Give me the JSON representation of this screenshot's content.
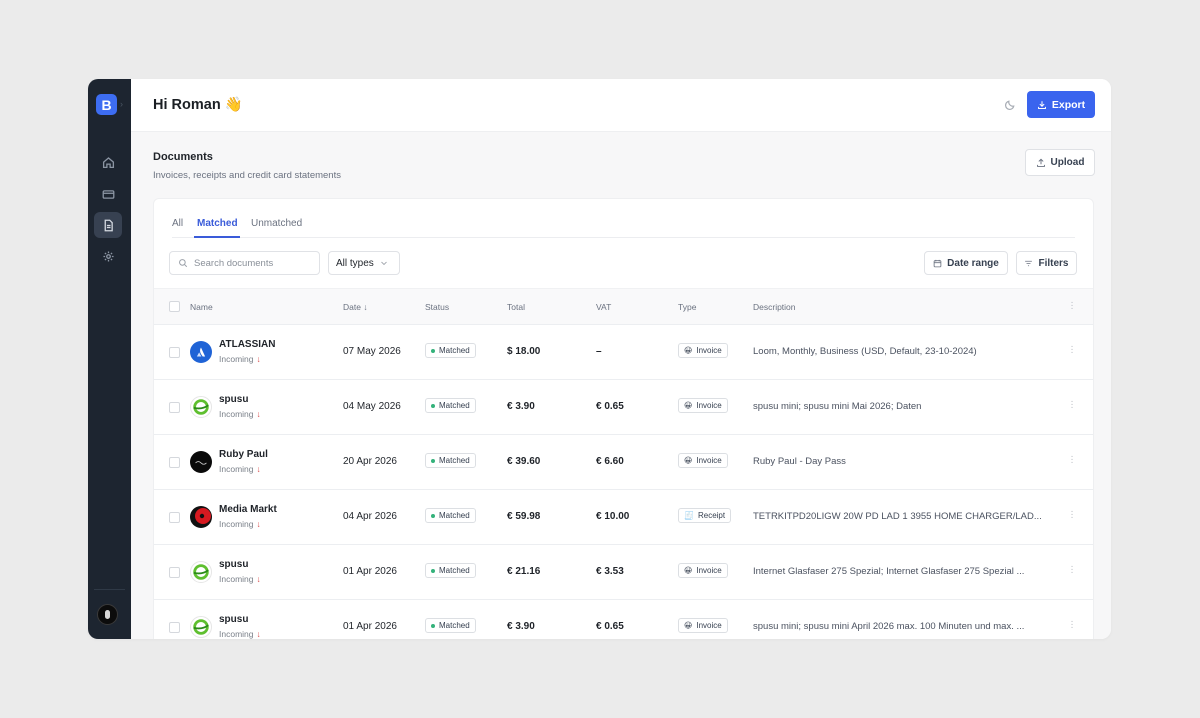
{
  "app": {
    "logo_letter": "B"
  },
  "sidebar": {
    "items": [
      {
        "name": "home",
        "icon": "home-icon"
      },
      {
        "name": "cards",
        "icon": "credit-card-icon"
      },
      {
        "name": "documents",
        "icon": "document-icon",
        "active": true
      },
      {
        "name": "settings",
        "icon": "gear-icon"
      }
    ]
  },
  "header": {
    "greeting": "Hi Roman 👋",
    "export_label": "Export"
  },
  "documents": {
    "title": "Documents",
    "subtitle": "Invoices, receipts and credit card statements",
    "upload_label": "Upload"
  },
  "tabs": [
    {
      "label": "All"
    },
    {
      "label": "Matched",
      "active": true
    },
    {
      "label": "Unmatched"
    }
  ],
  "toolbar": {
    "search_placeholder": "Search documents",
    "types_label": "All types",
    "date_range_label": "Date range",
    "filters_label": "Filters"
  },
  "table": {
    "columns": {
      "name": "Name",
      "date": "Date ↓",
      "status": "Status",
      "total": "Total",
      "vat": "VAT",
      "type": "Type",
      "description": "Description"
    },
    "rows": [
      {
        "vendor": "ATLASSIAN",
        "direction": "Incoming",
        "date": "07 May 2026",
        "status": "Matched",
        "total": "$ 18.00",
        "vat": "–",
        "type": "Invoice",
        "type_icon": "😀",
        "description": "Loom, Monthly, Business (USD, Default, 23-10-2024)",
        "logo": "atlassian"
      },
      {
        "vendor": "spusu",
        "direction": "Incoming",
        "date": "04 May 2026",
        "status": "Matched",
        "total": "€ 3.90",
        "vat": "€ 0.65",
        "type": "Invoice",
        "type_icon": "😀",
        "description": "spusu mini; spusu mini Mai 2026; Daten",
        "logo": "spusu"
      },
      {
        "vendor": "Ruby Paul",
        "direction": "Incoming",
        "date": "20 Apr 2026",
        "status": "Matched",
        "total": "€ 39.60",
        "vat": "€ 6.60",
        "type": "Invoice",
        "type_icon": "😀",
        "description": "Ruby Paul - Day Pass",
        "logo": "ruby"
      },
      {
        "vendor": "Media Markt",
        "direction": "Incoming",
        "date": "04 Apr 2026",
        "status": "Matched",
        "total": "€ 59.98",
        "vat": "€ 10.00",
        "type": "Receipt",
        "type_icon": "🧾",
        "description": "TETRKITPD20LIGW 20W PD LAD 1 3955 HOME CHARGER/LAD...",
        "logo": "mediamarkt"
      },
      {
        "vendor": "spusu",
        "direction": "Incoming",
        "date": "01 Apr 2026",
        "status": "Matched",
        "total": "€ 21.16",
        "vat": "€ 3.53",
        "type": "Invoice",
        "type_icon": "😀",
        "description": "Internet Glasfaser 275 Spezial; Internet Glasfaser 275 Spezial ...",
        "logo": "spusu"
      },
      {
        "vendor": "spusu",
        "direction": "Incoming",
        "date": "01 Apr 2026",
        "status": "Matched",
        "total": "€ 3.90",
        "vat": "€ 0.65",
        "type": "Invoice",
        "type_icon": "😀",
        "description": "spusu mini; spusu mini April 2026 max. 100 Minuten und max. ...",
        "logo": "spusu"
      }
    ]
  },
  "colors": {
    "accent": "#3a64ee",
    "sidebar": "#1d2530",
    "matched_dot": "#34b27b",
    "incoming_arrow": "#d64545"
  }
}
